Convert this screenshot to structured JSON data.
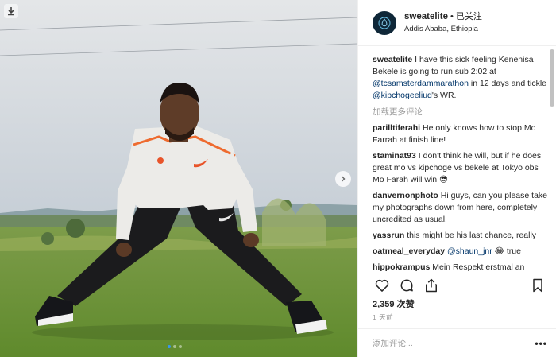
{
  "post": {
    "username": "sweatelite",
    "follow_status": "已关注",
    "separator": "•",
    "location": "Addis Ababa, Ethiopia"
  },
  "caption": {
    "username": "sweatelite",
    "text_1": "I have this sick feeling Kenenisa Bekele is going to run sub 2:02 at ",
    "mention_1": "@tcsamsterdammarathon",
    "text_2": " in 12 days and tickle ",
    "mention_2": "@kipchogeeliud",
    "text_3": "'s WR."
  },
  "load_more": "加载更多评论",
  "comments": [
    {
      "user": "parilltiferahi",
      "text": "He only knows how to stop Mo Farrah at finish line!"
    },
    {
      "user": "staminat93",
      "text": "I don't think he will, but if he does great mo vs kipchoge vs bekele at Tokyo obs Mo Farah will win 😎"
    },
    {
      "user": "danvernonphoto",
      "text": "Hi guys, can you please take my photographs down from here, completely uncredited as usual."
    },
    {
      "user": "yassrun",
      "text": "this might be his last chance, really"
    },
    {
      "user": "oatmeal_everyday",
      "mention": "@shaun_jnr",
      "text": " 😂  true"
    },
    {
      "user": "hippokrampus",
      "text": "Mein Respekt erstmal an Bekele den Marathon in dieser Zeit"
    }
  ],
  "likes": "2,359 次赞",
  "time": "1 天前",
  "add_comment_placeholder": "添加评论...",
  "more_options": "•••",
  "icons": {
    "download": "download-icon",
    "next": "chevron-right-icon",
    "like": "heart-icon",
    "comment": "comment-icon",
    "share": "share-icon",
    "save": "bookmark-icon"
  },
  "carousel": {
    "count": 3,
    "active": 1
  },
  "colors": {
    "accent": "#3897f0",
    "mention": "#003569",
    "muted": "#999999",
    "avatar_bg": "#0f2738"
  }
}
